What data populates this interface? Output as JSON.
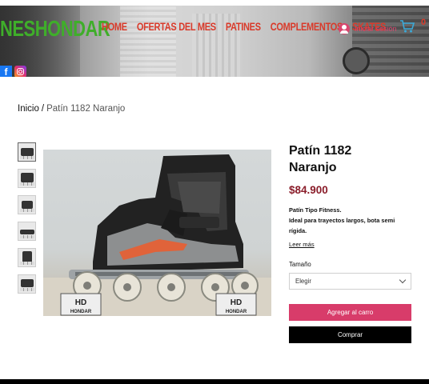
{
  "header": {
    "logo_text": "NESHONDAR",
    "nav": [
      "HOME",
      "OFERTAS DEL MES",
      "PATINES",
      "COMPLEMENTOS",
      "SKATES"
    ],
    "login_label": "Iniciar sesión",
    "cart_count": "0",
    "social": [
      "facebook-icon",
      "instagram-icon"
    ]
  },
  "breadcrumb": {
    "home": "Inicio",
    "separator": "/",
    "current": "Patín 1182 Naranjo"
  },
  "gallery": {
    "thumbnail_count": 6,
    "image_logo_text": "HONDAR"
  },
  "product": {
    "title_line1": "Patín 1182",
    "title_line2": "Naranjo",
    "price": "$84.900",
    "desc_line1": "Patín Tipo Fitness.",
    "desc_line2": "Ideal para trayectos largos, bota semi",
    "desc_line3": "rígida.",
    "read_more": "Leer más",
    "size_label": "Tamaño",
    "size_placeholder": "Elegir",
    "add_to_cart": "Agregar al carro",
    "buy": "Comprar"
  },
  "colors": {
    "logo_green": "#3fae2a",
    "nav_red": "#d93a2a",
    "accent_pink": "#d83c6a",
    "price_red": "#8a1d2a"
  }
}
